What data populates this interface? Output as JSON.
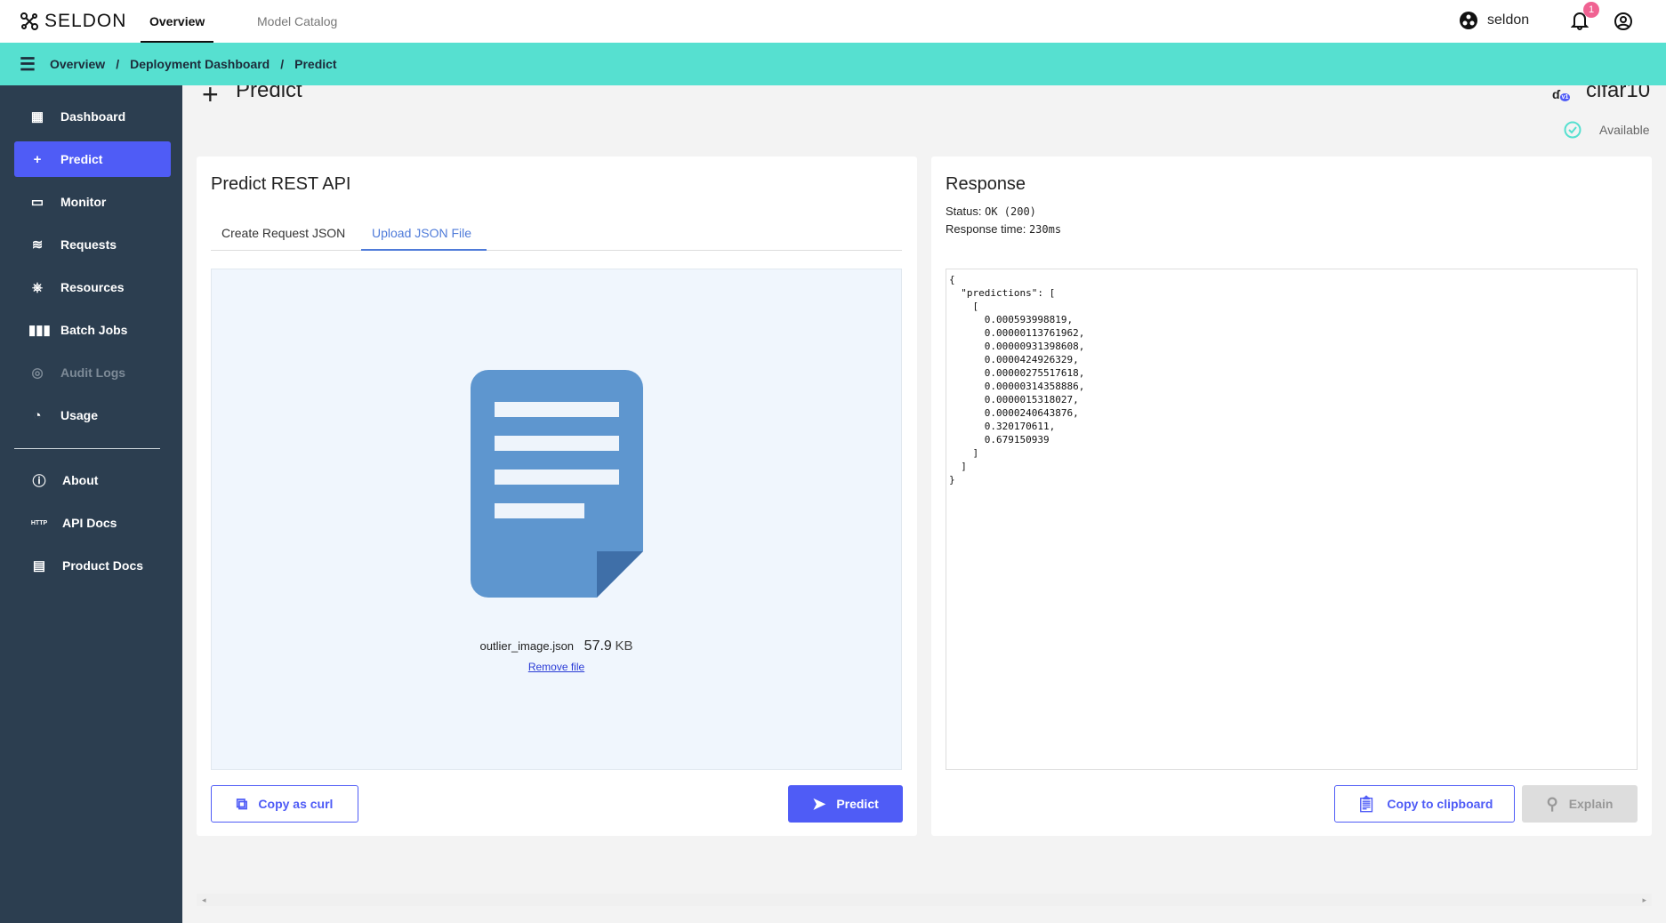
{
  "topbar": {
    "logo": "SELDON",
    "tabs": [
      "Overview",
      "Model Catalog"
    ],
    "user": "seldon",
    "notifications": "1"
  },
  "breadcrumb": [
    "Overview",
    "Deployment Dashboard",
    "Predict"
  ],
  "sidebar": {
    "items": [
      {
        "label": "Dashboard",
        "icon": "dashboard-icon"
      },
      {
        "label": "Predict",
        "icon": "plus-icon",
        "active": true
      },
      {
        "label": "Monitor",
        "icon": "monitor-icon"
      },
      {
        "label": "Requests",
        "icon": "requests-icon"
      },
      {
        "label": "Resources",
        "icon": "kubernetes-icon"
      },
      {
        "label": "Batch Jobs",
        "icon": "batch-icon"
      },
      {
        "label": "Audit Logs",
        "icon": "audit-icon",
        "disabled": true
      },
      {
        "label": "Usage",
        "icon": "gauge-icon"
      }
    ],
    "footer": [
      {
        "label": "About",
        "icon": "info-icon"
      },
      {
        "label": "API Docs",
        "icon": "http-icon"
      },
      {
        "label": "Product Docs",
        "icon": "docs-icon"
      }
    ]
  },
  "page": {
    "title": "Predict",
    "model_name": "cifar10",
    "version": "v1",
    "status": "Available"
  },
  "request": {
    "title": "Predict REST API",
    "tabs": [
      "Create Request JSON",
      "Upload JSON File"
    ],
    "file_name": "outlier_image.json",
    "file_size": "57.9",
    "file_unit": "KB",
    "remove": "Remove file",
    "copy_curl": "Copy as curl",
    "predict": "Predict"
  },
  "response": {
    "title": "Response",
    "status_label": "Status:",
    "status_value": "OK (200)",
    "time_label": "Response time:",
    "time_value": "230ms",
    "body": "{\n  \"predictions\": [\n    [\n      0.000593998819,\n      0.00000113761962,\n      0.00000931398608,\n      0.0000424926329,\n      0.00000275517618,\n      0.00000314358886,\n      0.0000015318027,\n      0.0000240643876,\n      0.320170611,\n      0.679150939\n    ]\n  ]\n}",
    "copy": "Copy to clipboard",
    "explain": "Explain"
  },
  "colors": {
    "accent": "#4f5cf6",
    "teal": "#56e0d0",
    "sidebar": "#2c3e50"
  }
}
